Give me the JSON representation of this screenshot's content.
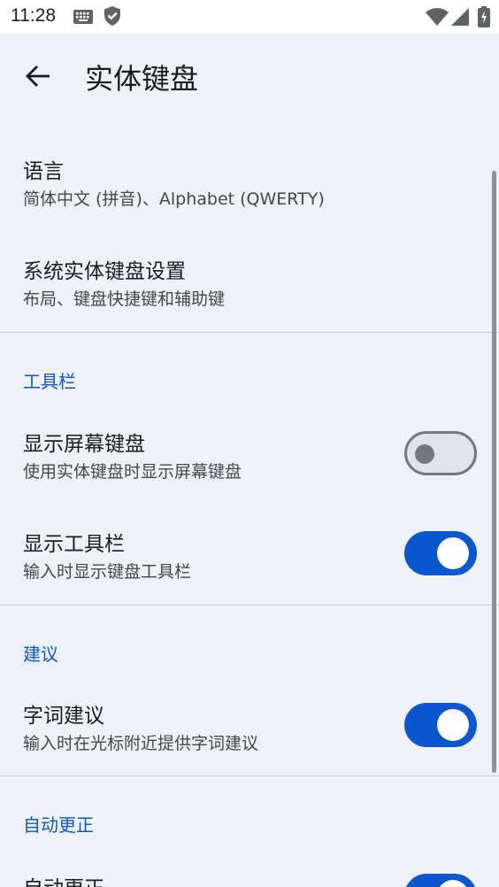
{
  "status_bar": {
    "time": "11:28",
    "icons": [
      "keyboard-icon",
      "shield-check-icon",
      "wifi-icon",
      "signal-icon",
      "battery-charging-icon"
    ]
  },
  "app_bar": {
    "back_icon": "arrow-back-icon",
    "title": "实体键盘"
  },
  "items": {
    "language": {
      "title": "语言",
      "summary": "简体中文 (拼音)、Alphabet (QWERTY)"
    },
    "system_settings": {
      "title": "系统实体键盘设置",
      "summary": "布局、键盘快捷键和辅助键"
    }
  },
  "sections": {
    "toolbar": {
      "header": "工具栏",
      "show_onscreen": {
        "title": "显示屏幕键盘",
        "summary": "使用实体键盘时显示屏幕键盘",
        "enabled": false
      },
      "show_toolbar": {
        "title": "显示工具栏",
        "summary": "输入时显示键盘工具栏",
        "enabled": true
      }
    },
    "suggestions": {
      "header": "建议",
      "word_suggestions": {
        "title": "字词建议",
        "summary": "输入时在光标附近提供字词建议",
        "enabled": true
      }
    },
    "autocorrect": {
      "header": "自动更正",
      "autocorrect_item": {
        "title": "自动更正",
        "enabled": true
      }
    }
  },
  "colors": {
    "accent": "#0b57d0",
    "background": "#eef1f7",
    "switch_off_track": "#e1e3e9",
    "switch_off_outline": "#74777f"
  }
}
